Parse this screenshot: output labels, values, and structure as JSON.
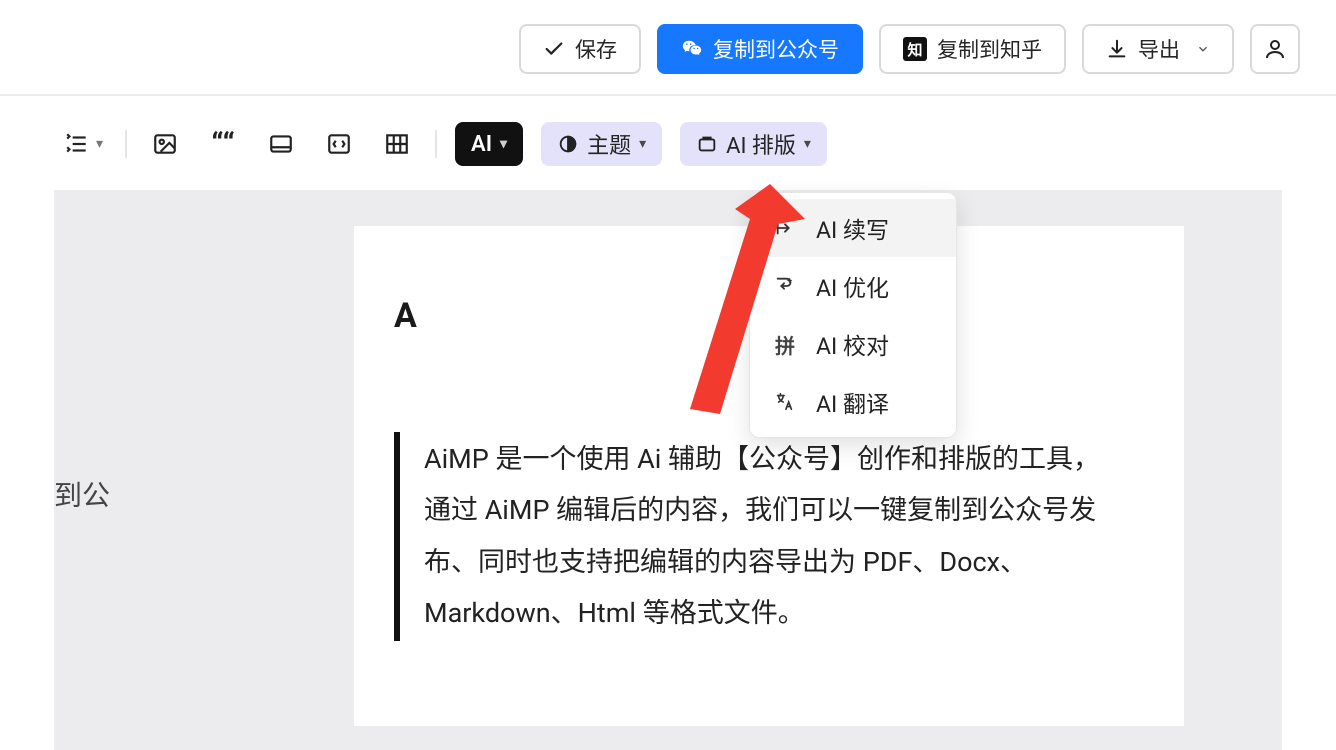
{
  "topbar": {
    "save_label": "保存",
    "copy_wechat_label": "复制到公众号",
    "copy_zhihu_label": "复制到知乎",
    "export_label": "导出"
  },
  "toolbar": {
    "ai_badge": "AI",
    "theme_label": "主题",
    "ai_layout_label": "AI 排版"
  },
  "ai_menu": {
    "items": [
      {
        "label": "AI 续写"
      },
      {
        "label": "AI 优化"
      },
      {
        "label": "AI 校对"
      },
      {
        "label": "AI 翻译"
      }
    ],
    "icon2_text": "拼"
  },
  "side_fragment": "到公",
  "doc": {
    "heading_fragment_left": "A",
    "heading_fragment_right": "？",
    "quote_text": "AiMP 是一个使用 Ai 辅助【公众号】创作和排版的工具，通过 AiMP 编辑后的内容，我们可以一键复制到公众号发布、同时也支持把编辑的内容导出为 PDF、Docx、Markdown、Html 等格式文件。"
  }
}
